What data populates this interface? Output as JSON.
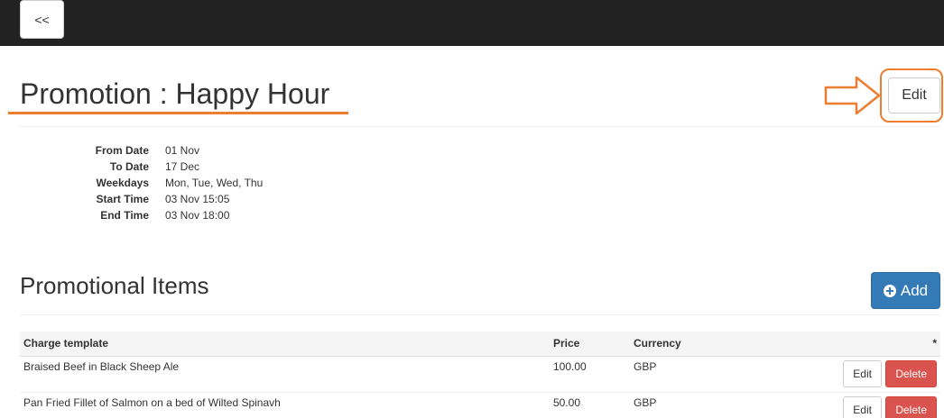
{
  "nav": {
    "back_label": "<<"
  },
  "header": {
    "title": "Promotion : Happy Hour",
    "edit_label": "Edit"
  },
  "details": [
    {
      "label": "From Date",
      "value": "01 Nov"
    },
    {
      "label": "To Date",
      "value": "17 Dec"
    },
    {
      "label": "Weekdays",
      "value": "Mon, Tue, Wed, Thu"
    },
    {
      "label": "Start Time",
      "value": "03 Nov 15:05"
    },
    {
      "label": "End Time",
      "value": "03 Nov 18:00"
    }
  ],
  "items_section": {
    "title": "Promotional Items",
    "add_label": "Add",
    "columns": {
      "name": "Charge template",
      "price": "Price",
      "currency": "Currency",
      "actions": "*"
    },
    "rows": [
      {
        "name": "Braised Beef in Black Sheep Ale",
        "price": "100.00",
        "currency": "GBP",
        "edit": "Edit",
        "delete": "Delete"
      },
      {
        "name": "Pan Fried Fillet of Salmon on a bed of Wilted Spinavh",
        "price": "50.00",
        "currency": "GBP",
        "edit": "Edit",
        "delete": "Delete"
      }
    ]
  },
  "colors": {
    "annotation": "#ed7d31",
    "primary": "#337ab7",
    "danger": "#d9534f",
    "topbar": "#222222"
  }
}
